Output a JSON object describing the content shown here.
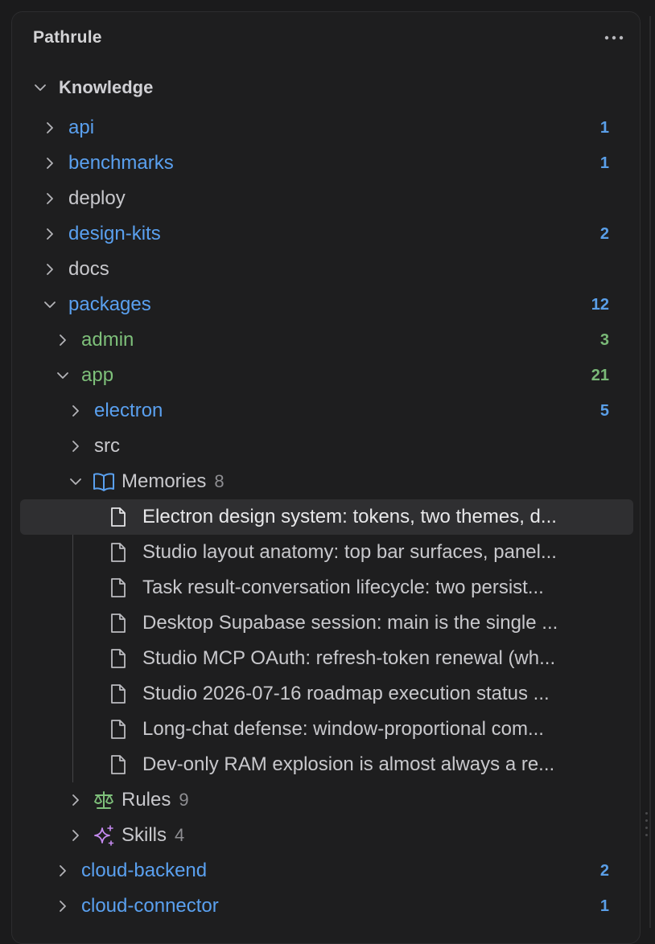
{
  "panel": {
    "title": "Pathrule",
    "more_label": "···"
  },
  "tree": {
    "knowledge": {
      "label": "Knowledge"
    },
    "items": [
      {
        "label": "api",
        "count": "1"
      },
      {
        "label": "benchmarks",
        "count": "1"
      },
      {
        "label": "deploy",
        "count": ""
      },
      {
        "label": "design-kits",
        "count": "2"
      },
      {
        "label": "docs",
        "count": ""
      },
      {
        "label": "packages",
        "count": "12"
      },
      {
        "label": "admin",
        "count": "3"
      },
      {
        "label": "app",
        "count": "21"
      },
      {
        "label": "electron",
        "count": "5"
      },
      {
        "label": "src",
        "count": ""
      },
      {
        "label": "cloud-backend",
        "count": "2"
      },
      {
        "label": "cloud-connector",
        "count": "1"
      }
    ],
    "memories": {
      "label": "Memories",
      "count": "8",
      "files": [
        "Electron design system: tokens, two themes, d...",
        "Studio layout anatomy: top bar surfaces, panel...",
        "Task result-conversation lifecycle: two persist...",
        "Desktop Supabase session: main is the single ...",
        "Studio MCP OAuth: refresh-token renewal (wh...",
        "Studio 2026-07-16 roadmap execution status ...",
        "Long-chat defense: window-proportional com...",
        "Dev-only RAM explosion is almost always a re..."
      ]
    },
    "rules": {
      "label": "Rules",
      "count": "9"
    },
    "skills": {
      "label": "Skills",
      "count": "4"
    }
  },
  "colors": {
    "folder_blue": "#5aa0ef",
    "folder_green": "#7ec07a",
    "selection": "#2f2f31",
    "skills_accent": "#c58af0"
  },
  "icons": {
    "expanded": "chevron-down-icon",
    "collapsed": "chevron-right-icon",
    "memories": "book-icon",
    "rules": "scales-icon",
    "skills": "sparkles-icon",
    "file": "file-icon",
    "more": "more-horizontal-icon"
  }
}
